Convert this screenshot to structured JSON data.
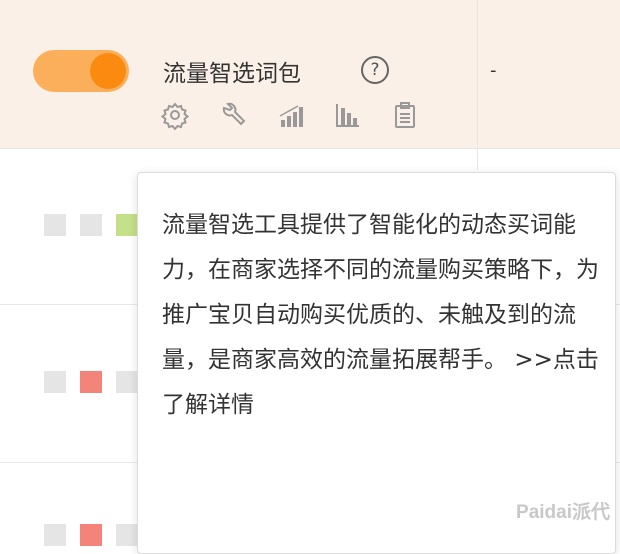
{
  "row": {
    "title": "流量智选词包",
    "help_glyph": "?",
    "value": "-",
    "toggle_on": true,
    "actions": [
      "gear-icon",
      "wrench-icon",
      "bar-chart-rising-icon",
      "bar-chart-icon",
      "clipboard-icon"
    ]
  },
  "tooltip": {
    "text": "流量智选工具提供了智能化的动态买词能力，在商家选择不同的流量购买策略下，为推广宝贝自动购买优质的、未触及到的流量，是商家高效的流量拓展帮手。",
    "link": ">>点击了解详情"
  },
  "watermark": "Paidai派代",
  "colors": {
    "row_bg": "#fbf0e7",
    "toggle_track": "#fcaf5b",
    "toggle_knob": "#fa8b10",
    "status_green": "#c4e08a",
    "status_red": "#f4847a"
  }
}
